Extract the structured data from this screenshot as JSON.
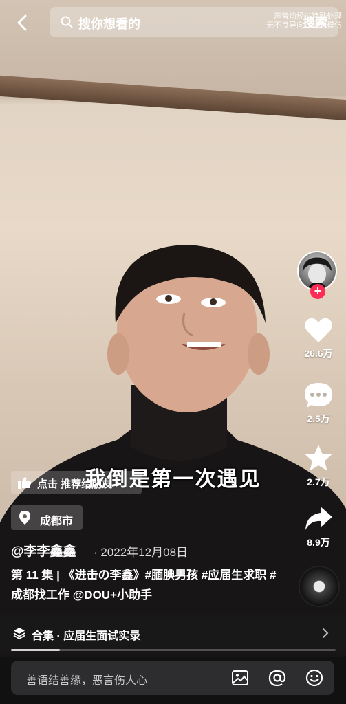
{
  "top_bar": {
    "search_placeholder": "搜你想看的",
    "search_button": "搜索",
    "notice_line1": "声音均经过特殊处理",
    "notice_line2": "无不良导向，请勿模仿"
  },
  "video": {
    "subtitle": "我倒是第一次遇见"
  },
  "side_rail": {
    "like_count": "26.6万",
    "comment_count": "2.5万",
    "favorite_count": "2.7万",
    "share_count": "8.9万"
  },
  "recommend_pill": {
    "label": "点击 推荐给朋友 >"
  },
  "location": {
    "label": "成都市"
  },
  "post": {
    "author": "@李李鑫鑫",
    "date": "· 2022年12月08日",
    "caption": "第 11 集 | 《进击の李鑫》#腼腆男孩 #应届生求职 #成都找工作 @DOU+小助手"
  },
  "collection": {
    "label": "合集 · 应届生面试实录"
  },
  "playback": {
    "progress": 0.15
  },
  "comment_bar": {
    "placeholder": "善语结善缘，恶言伤人心"
  },
  "colors": {
    "accent": "#fe2c55"
  }
}
